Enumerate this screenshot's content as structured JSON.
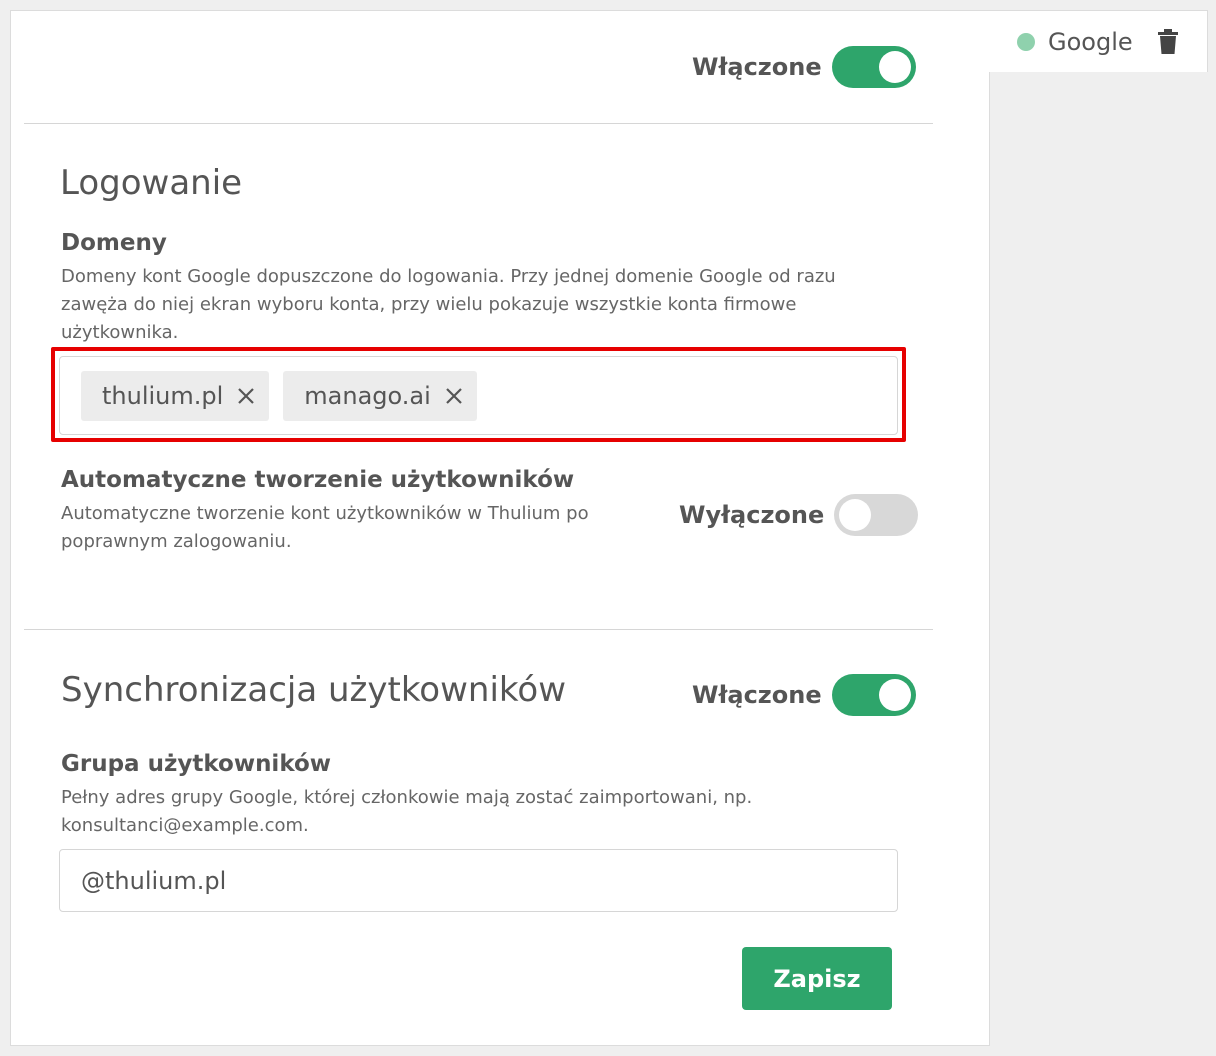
{
  "provider_tab": {
    "label": "Google",
    "status_color": "#8fd1ad",
    "delete_icon": "trash-icon"
  },
  "main_toggle": {
    "label": "Włączone",
    "state": "on"
  },
  "login_section": {
    "title": "Logowanie",
    "domains": {
      "title": "Domeny",
      "description_line1": "Domeny kont Google dopuszczone do logowania. Przy jednej domenie Google od razu",
      "description_line2": "zawęża do niej ekran wyboru konta, przy wielu pokazuje wszystkie konta firmowe",
      "description_line3": "użytkownika.",
      "tags": [
        {
          "label": "thulium.pl"
        },
        {
          "label": "manago.ai"
        }
      ]
    },
    "auto_create": {
      "title": "Automatyczne tworzenie użytkowników",
      "description_line1": "Automatyczne tworzenie kont użytkowników w Thulium po",
      "description_line2": "poprawnym zalogowaniu.",
      "toggle_label": "Wyłączone",
      "state": "off"
    }
  },
  "sync_section": {
    "title": "Synchronizacja użytkowników",
    "toggle_label": "Włączone",
    "state": "on",
    "group": {
      "title": "Grupa użytkowników",
      "description_line1": "Pełny adres grupy Google, której członkowie mają zostać zaimportowani, np.",
      "description_line2": "konsultanci@example.com.",
      "value": "@thulium.pl"
    }
  },
  "save_label": "Zapisz",
  "colors": {
    "accent": "#2ea56b",
    "highlight": "#e60000",
    "toggle_off": "#d8d8d8"
  }
}
